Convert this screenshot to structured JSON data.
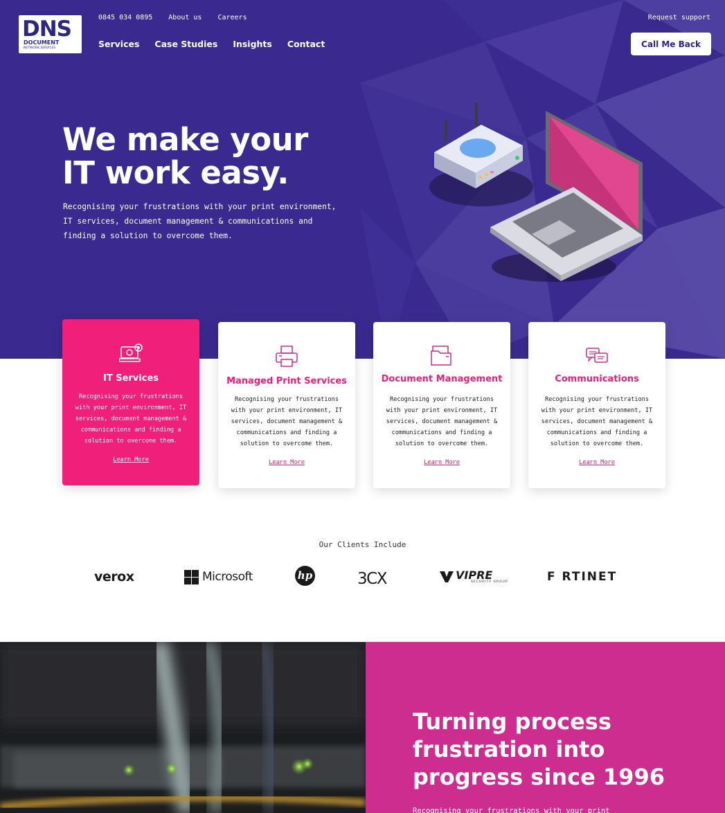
{
  "brand": {
    "logo_big": "DNS",
    "logo_line1": "DOCUMENT",
    "logo_line2": "NETWORK SERVICES"
  },
  "topbar": {
    "phone": "0845 034 0895",
    "about": "About us",
    "careers": "Careers",
    "request_support": "Request support"
  },
  "nav": {
    "items": [
      {
        "label": "Services"
      },
      {
        "label": "Case Studies"
      },
      {
        "label": "Insights"
      },
      {
        "label": "Contact"
      }
    ],
    "cta": "Call Me Back"
  },
  "hero": {
    "title_line1": "We make your",
    "title_line2": "IT work easy.",
    "text_line1": "Recognising your frustrations with your print environment,",
    "text_line2": "IT services, document management & communications and",
    "text_line3": "finding a solution to overcome them."
  },
  "cards": [
    {
      "title": "IT Services",
      "l1": "Recognising your frustrations",
      "l2": "with your print environment, IT",
      "l3": "services, document management &",
      "l4": "communications and finding a",
      "l5": "solution to overcome them.",
      "link": "Learn More",
      "icon": "laptop-gear-icon"
    },
    {
      "title": "Managed Print Services",
      "l1": "Recognising your frustrations",
      "l2": "with your print environment, IT",
      "l3": "services, document management &",
      "l4": "communications and finding a",
      "l5": "solution to overcome them.",
      "link": "Learn More",
      "icon": "printer-icon"
    },
    {
      "title": "Document Management",
      "l1": "Recognising your frustrations",
      "l2": "with your print environment, IT",
      "l3": "services, document management &",
      "l4": "communications and finding a",
      "l5": "solution to overcome them.",
      "link": "Learn More",
      "icon": "folder-icon"
    },
    {
      "title": "Communications",
      "l1": "Recognising your frustrations",
      "l2": "with your print environment, IT",
      "l3": "services, document management &",
      "l4": "communications and finding a",
      "l5": "solution to overcome them.",
      "link": "Learn More",
      "icon": "chat-bubbles-icon"
    }
  ],
  "clients": {
    "title": "Our Clients Include",
    "logos": {
      "xerox": "verox",
      "microsoft": "Microsoft",
      "hp": "hp",
      "threecx": "3CX",
      "vipre": "VIPRE",
      "vipre_sub": "SECURITY GROUP",
      "fortinet": "F RTINET"
    }
  },
  "bottom": {
    "line1": "Turning process",
    "line2": "frustration into",
    "line3": "progress since 1996",
    "text": "Recognising your frustrations with your print"
  },
  "colors": {
    "hero_bg": "#3a2a8f",
    "accent_pink": "#f0207a",
    "magenta_panel": "#cc2d8e",
    "brand_navy": "#2d2680"
  }
}
